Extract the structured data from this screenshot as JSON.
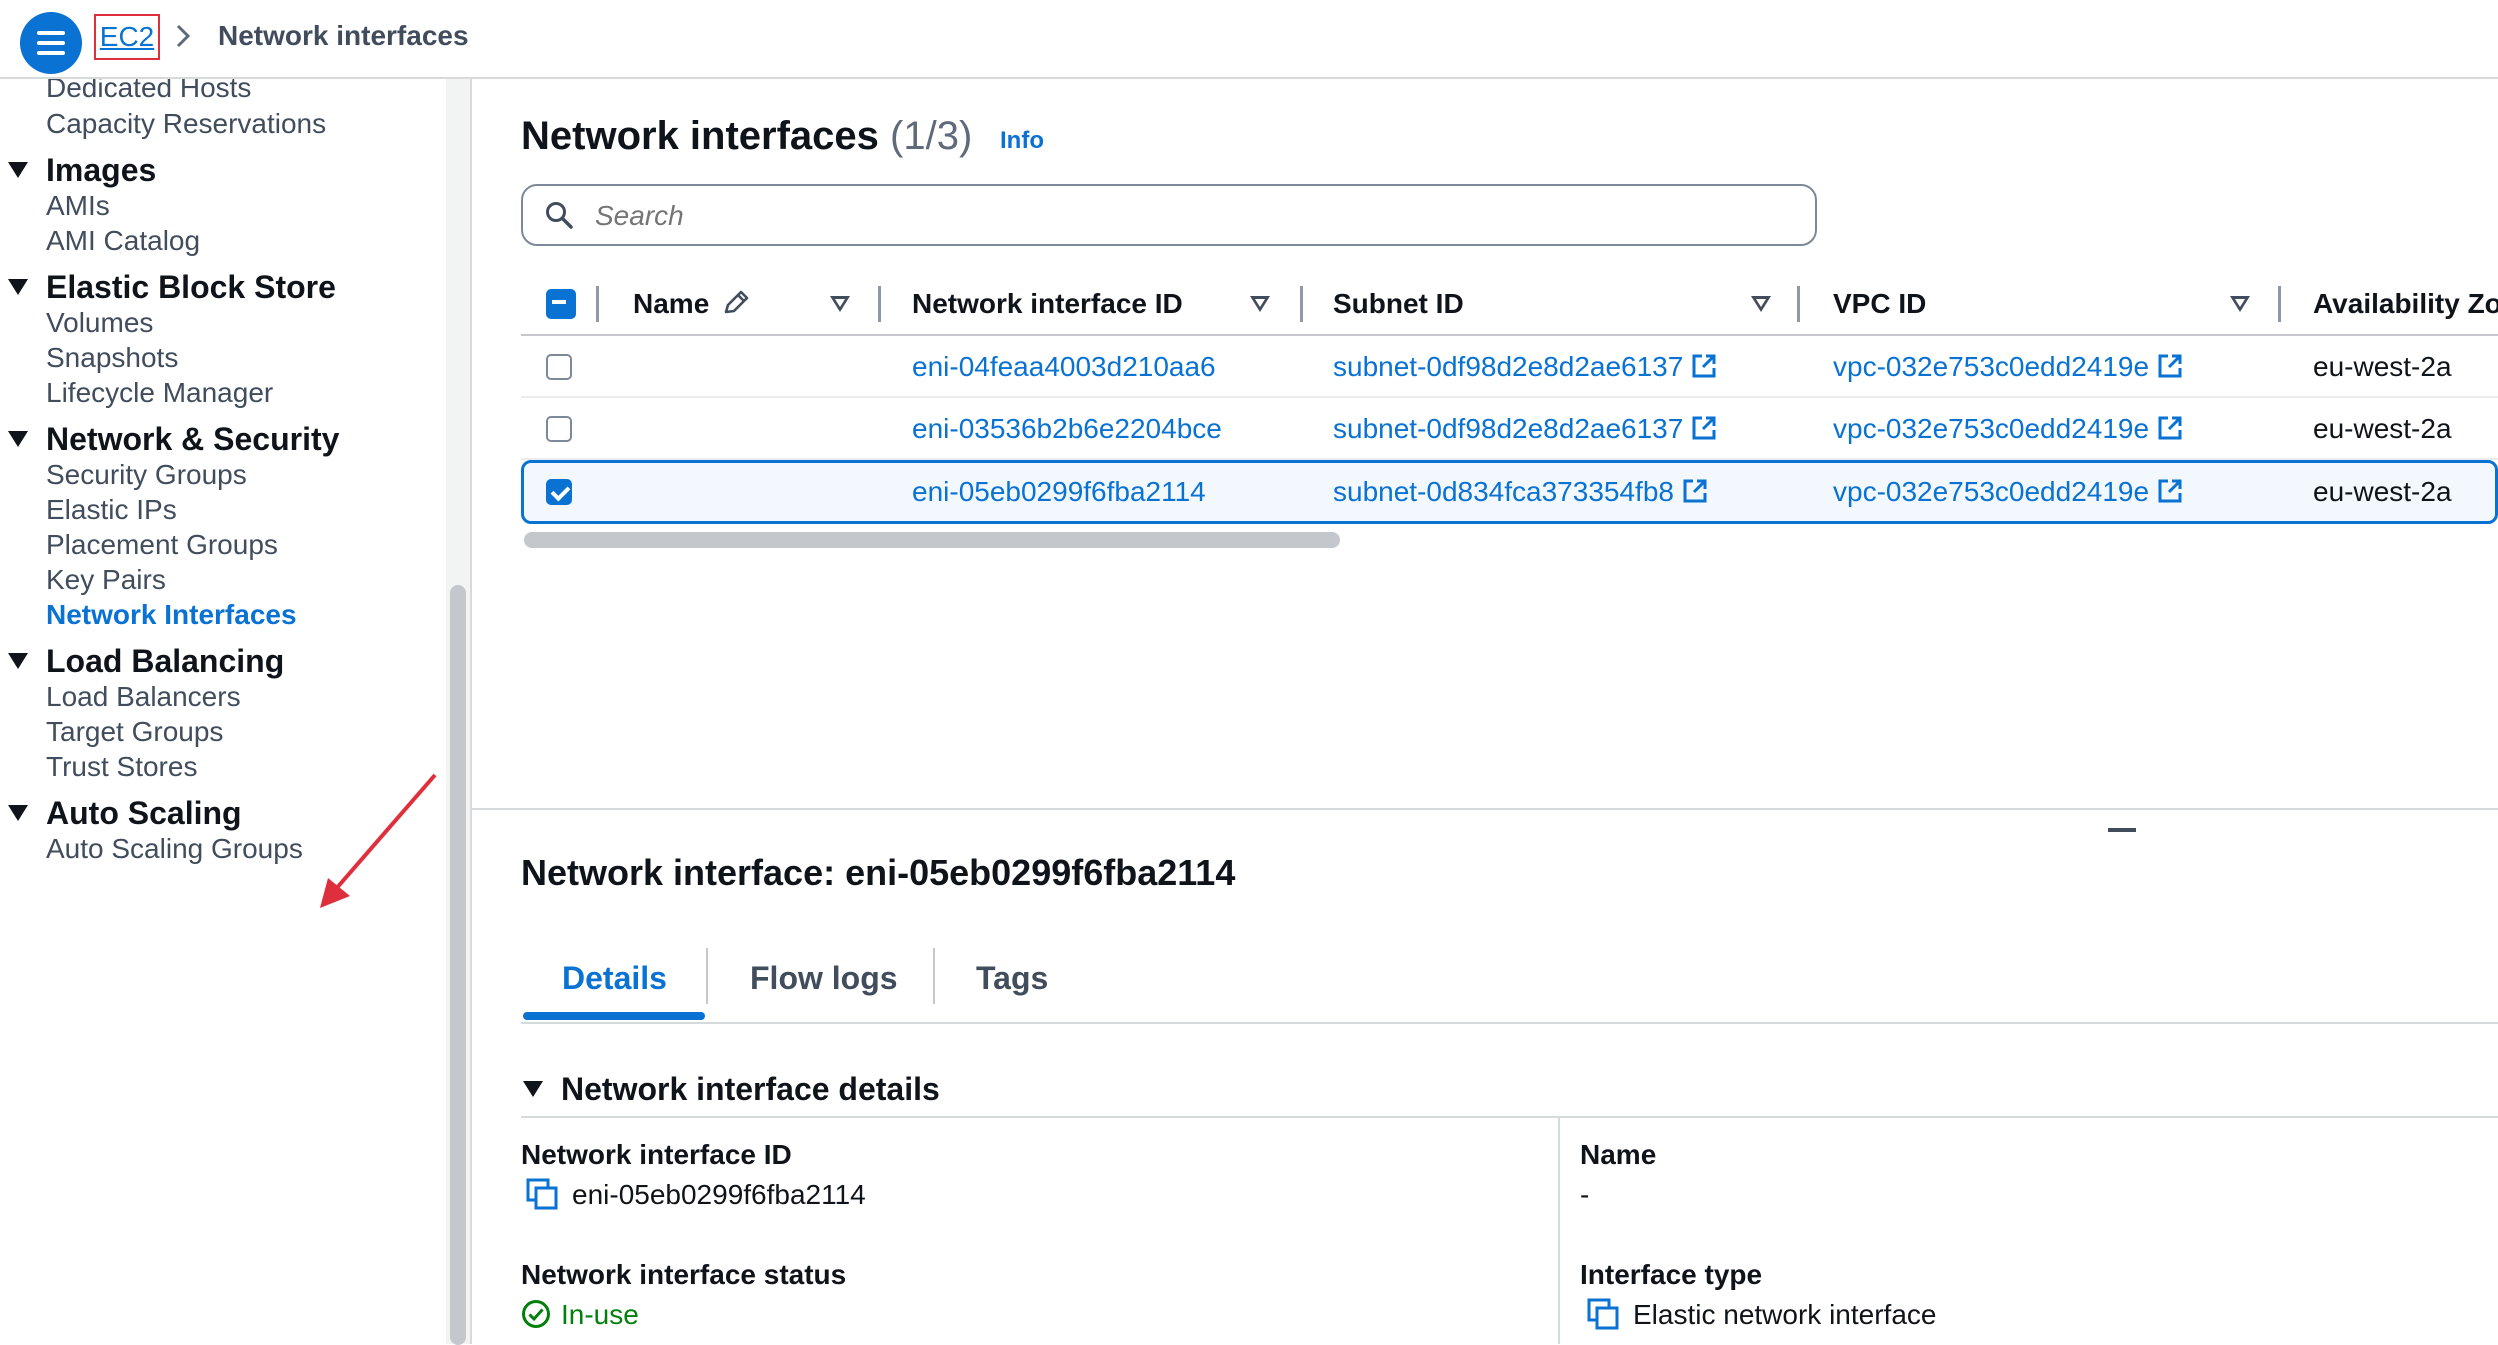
{
  "breadcrumb": {
    "root": "EC2",
    "separator": ">",
    "current": "Network interfaces"
  },
  "sidebar": {
    "items": [
      {
        "label": "Dedicated Hosts",
        "type": "item"
      },
      {
        "label": "Capacity Reservations",
        "type": "item"
      },
      {
        "label": "Images",
        "type": "section"
      },
      {
        "label": "AMIs",
        "type": "item"
      },
      {
        "label": "AMI Catalog",
        "type": "item"
      },
      {
        "label": "Elastic Block Store",
        "type": "section"
      },
      {
        "label": "Volumes",
        "type": "item"
      },
      {
        "label": "Snapshots",
        "type": "item"
      },
      {
        "label": "Lifecycle Manager",
        "type": "item"
      },
      {
        "label": "Network & Security",
        "type": "section"
      },
      {
        "label": "Security Groups",
        "type": "item"
      },
      {
        "label": "Elastic IPs",
        "type": "item"
      },
      {
        "label": "Placement Groups",
        "type": "item"
      },
      {
        "label": "Key Pairs",
        "type": "item"
      },
      {
        "label": "Network Interfaces",
        "type": "item",
        "active": true
      },
      {
        "label": "Load Balancing",
        "type": "section"
      },
      {
        "label": "Load Balancers",
        "type": "item"
      },
      {
        "label": "Target Groups",
        "type": "item"
      },
      {
        "label": "Trust Stores",
        "type": "item"
      },
      {
        "label": "Auto Scaling",
        "type": "section"
      },
      {
        "label": "Auto Scaling Groups",
        "type": "item"
      }
    ]
  },
  "main": {
    "title": "Network interfaces",
    "count": "(1/3)",
    "info_link": "Info",
    "search": {
      "placeholder": "Search",
      "value": ""
    },
    "table": {
      "columns": [
        "Name",
        "Network interface ID",
        "Subnet ID",
        "VPC ID",
        "Availability Zo"
      ],
      "rows": [
        {
          "name": "",
          "eni": "eni-04feaa4003d210aa6",
          "subnet": "subnet-0df98d2e8d2ae6137",
          "vpc": "vpc-032e753c0edd2419e",
          "az": "eu-west-2a",
          "selected": false
        },
        {
          "name": "",
          "eni": "eni-03536b2b6e2204bce",
          "subnet": "subnet-0df98d2e8d2ae6137",
          "vpc": "vpc-032e753c0edd2419e",
          "az": "eu-west-2a",
          "selected": false
        },
        {
          "name": "",
          "eni": "eni-05eb0299f6fba2114",
          "subnet": "subnet-0d834fca373354fb8",
          "vpc": "vpc-032e753c0edd2419e",
          "az": "eu-west-2a",
          "selected": true
        }
      ]
    }
  },
  "details": {
    "title": "Network interface: eni-05eb0299f6fba2114",
    "tabs": [
      "Details",
      "Flow logs",
      "Tags"
    ],
    "active_tab": "Details",
    "section_title": "Network interface details",
    "fields": {
      "eni_id_label": "Network interface ID",
      "eni_id_value": "eni-05eb0299f6fba2114",
      "name_label": "Name",
      "name_value": "-",
      "status_label": "Network interface status",
      "status_value": "In-use",
      "type_label": "Interface type",
      "type_value": "Elastic network interface"
    }
  },
  "colors": {
    "accent": "#0972d3",
    "success": "#037f0c",
    "annotation": "#e02f3c"
  }
}
